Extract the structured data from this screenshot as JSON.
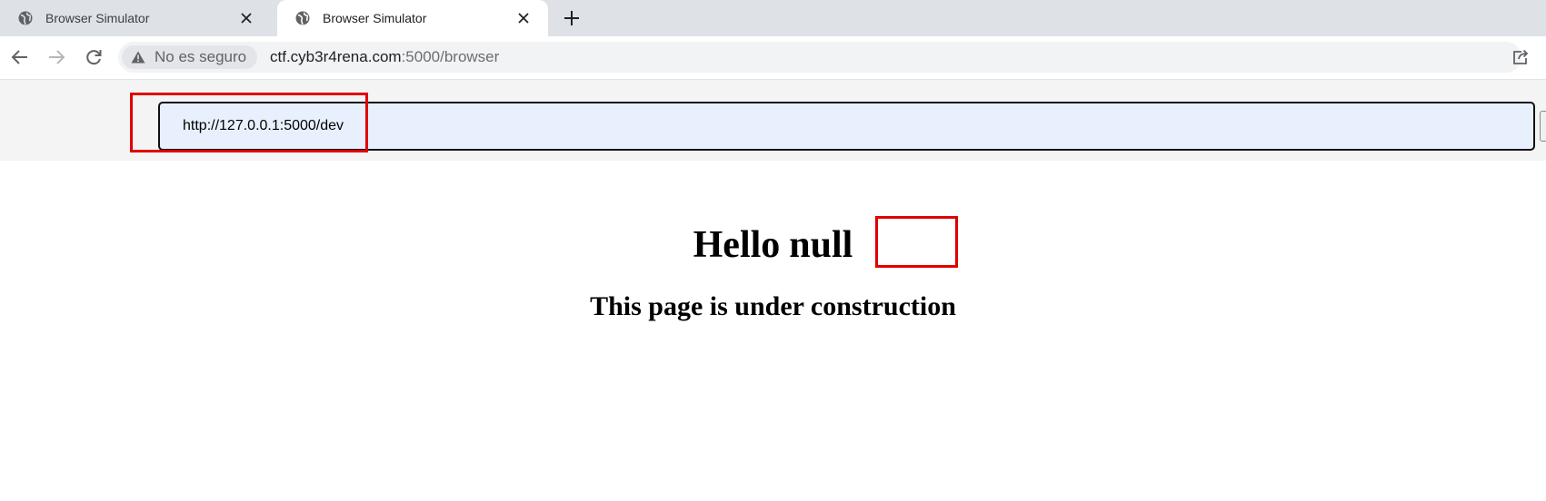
{
  "tabs": [
    {
      "title": "Browser Simulator",
      "icon": "globe-icon",
      "active": false
    },
    {
      "title": "Browser Simulator",
      "icon": "globe-icon",
      "active": true
    }
  ],
  "toolbar": {
    "security_label": "No es seguro",
    "url_host": "ctf.cyb3r4rena.com",
    "url_path": ":5000/browser"
  },
  "simulator": {
    "url_value": "http://127.0.0.1:5000/dev"
  },
  "page": {
    "greeting": "Hello",
    "name": "null",
    "subtitle": "This page is under construction"
  },
  "colors": {
    "annotation": "#e00000",
    "tabstrip": "#dee1e6",
    "input_fill": "#e8f0fe"
  }
}
